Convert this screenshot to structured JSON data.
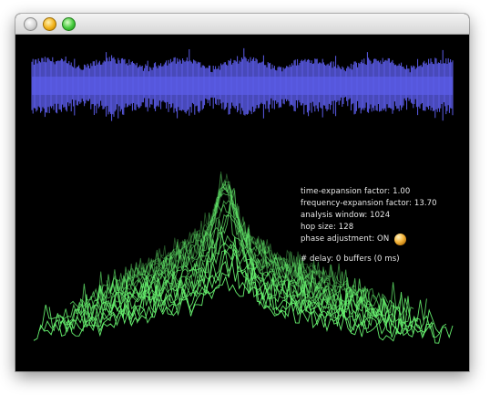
{
  "window": {
    "controls": [
      "close",
      "minimize",
      "zoom"
    ]
  },
  "colors": {
    "waveform": "#5b5ce8",
    "spectrum": "#66f06e",
    "background": "#000000",
    "text": "#e8e8e8"
  },
  "info": {
    "time_expansion": "time-expansion factor: 1.00",
    "frequency_expansion": "frequency-expansion factor: 13.70",
    "analysis_window": "analysis window: 1024",
    "hop_size": "hop size: 128",
    "phase_adjustment": "phase adjustment: ON",
    "delay": "# delay: 0 buffers (0 ms)"
  }
}
